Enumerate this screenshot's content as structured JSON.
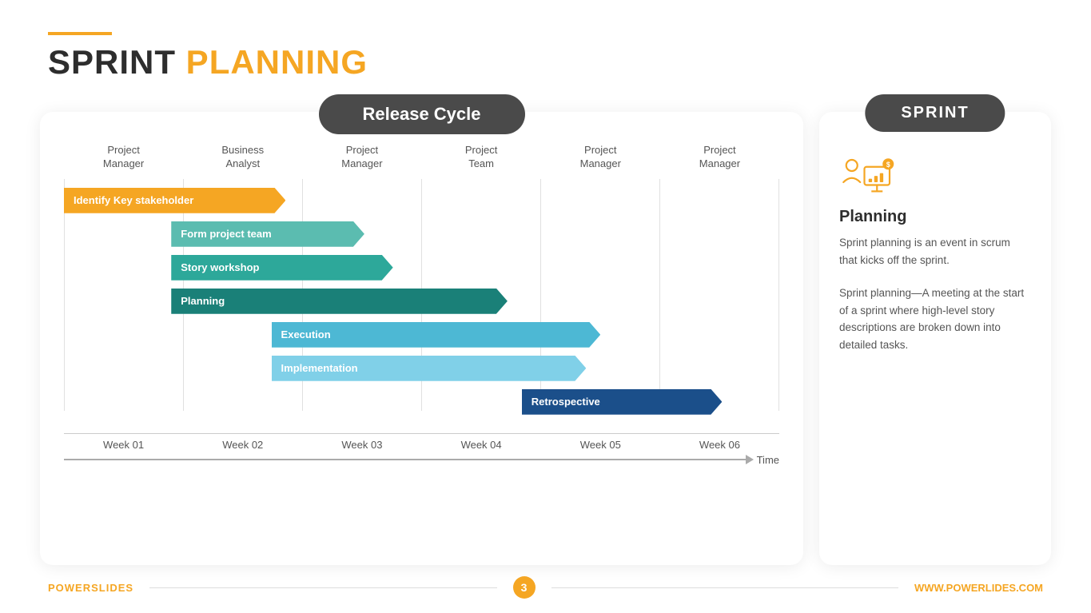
{
  "header": {
    "line_decoration": true,
    "title_dark": "SPRINT",
    "title_gold": " PLANNING"
  },
  "release_cycle": {
    "badge_label": "Release Cycle",
    "col_headers": [
      {
        "label": "Project\nManager",
        "id": "col1"
      },
      {
        "label": "Business\nAnalyst",
        "id": "col2"
      },
      {
        "label": "Project\nManager",
        "id": "col3"
      },
      {
        "label": "Project\nTeam",
        "id": "col4"
      },
      {
        "label": "Project\nManager",
        "id": "col5"
      },
      {
        "label": "Project\nManager",
        "id": "col6"
      }
    ],
    "bars": [
      {
        "label": "Identify Key stakeholder",
        "color": "#F5A623",
        "left_pct": 0,
        "width_pct": 32
      },
      {
        "label": "Form project team",
        "color": "#5BBCB0",
        "left_pct": 14,
        "width_pct": 28
      },
      {
        "label": "Story workshop",
        "color": "#2DA89A",
        "left_pct": 14,
        "width_pct": 32
      },
      {
        "label": "Planning",
        "color": "#1A8078",
        "left_pct": 14,
        "width_pct": 48
      },
      {
        "label": "Execution",
        "color": "#4DB8D4",
        "left_pct": 28,
        "width_pct": 48
      },
      {
        "label": "Implementation",
        "color": "#80D0E8",
        "left_pct": 28,
        "width_pct": 46
      },
      {
        "label": "Retrospective",
        "color": "#1B4F8A",
        "left_pct": 64,
        "width_pct": 28
      }
    ],
    "week_labels": [
      "Week 01",
      "Week 02",
      "Week 03",
      "Week 04",
      "Week 05",
      "Week 06"
    ],
    "time_label": "Time"
  },
  "sprint_panel": {
    "badge_label": "SPRINT",
    "icon_semantic": "analytics-person-icon",
    "subtitle": "Planning",
    "text1": "Sprint planning is an event in scrum that kicks off the sprint.",
    "text2": "Sprint planning—A meeting at the start of a sprint where high-level story descriptions are broken down into detailed tasks."
  },
  "footer": {
    "brand_left_dark": "POWER",
    "brand_left_gold": "SLIDES",
    "page_number": "3",
    "brand_right": "WWW.POWERLIDES.COM"
  }
}
